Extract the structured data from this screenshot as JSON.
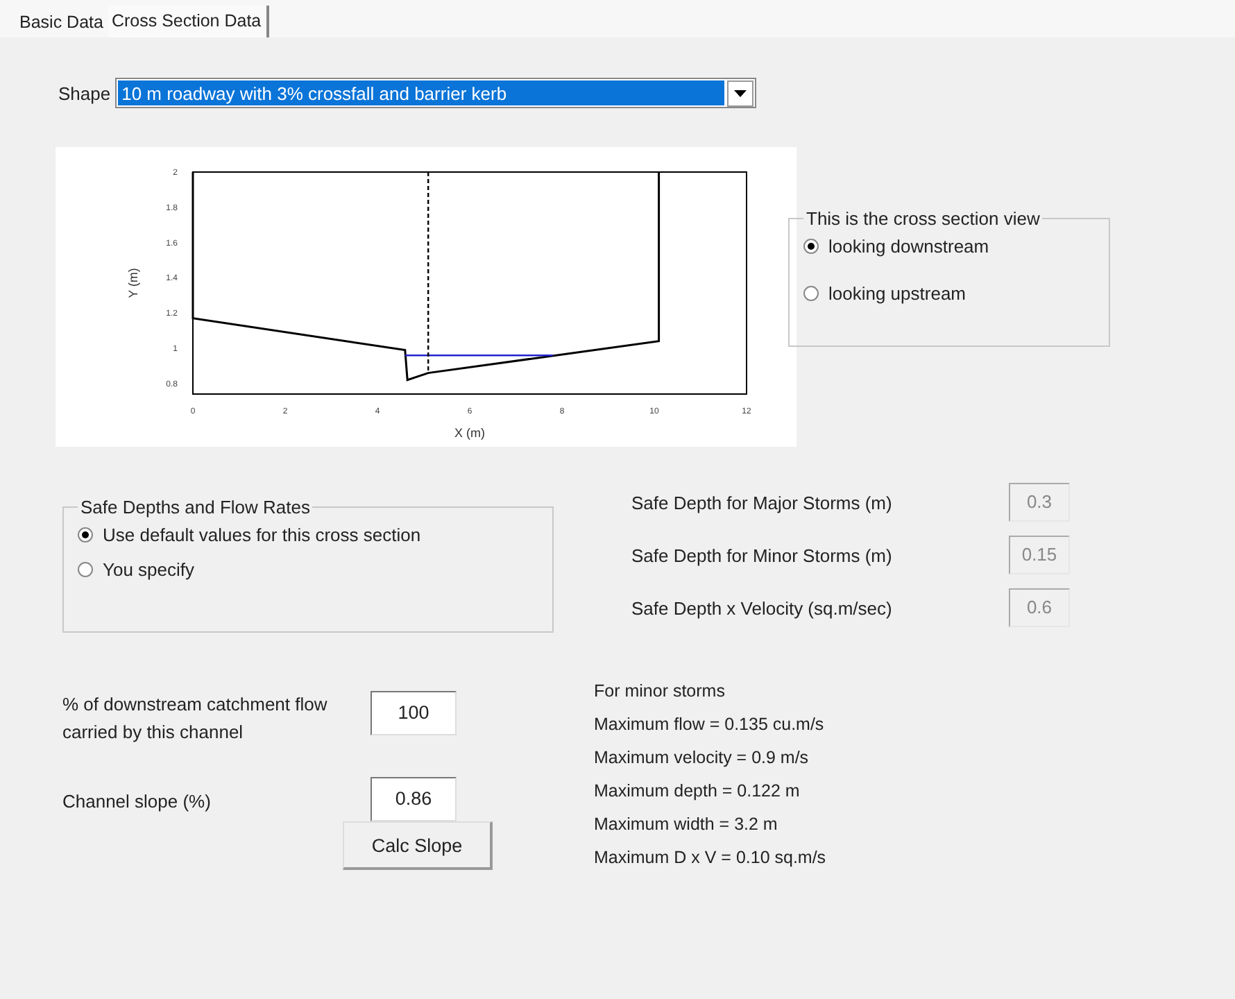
{
  "tabs": [
    {
      "label": "Basic Data",
      "selected": false
    },
    {
      "label": "Cross Section Data",
      "selected": true
    }
  ],
  "shape": {
    "label": "Shape",
    "value": "10 m roadway with 3% crossfall and barrier kerb"
  },
  "cross_section_chart": {
    "chart_data": {
      "type": "line",
      "xlabel": "X (m)",
      "ylabel": "Y (m)",
      "xlim": [
        0,
        12
      ],
      "ylim": [
        0.74,
        2
      ],
      "xticks": [
        0,
        2,
        4,
        6,
        8,
        10,
        12
      ],
      "yticks": [
        {
          "value": 0.8,
          "label": "0.8"
        },
        {
          "value": 1,
          "label": "1"
        },
        {
          "value": 1.2,
          "label": "1.2"
        },
        {
          "value": 1.4,
          "label": "1.4"
        },
        {
          "value": 1.6,
          "label": "1.6"
        },
        {
          "value": 1.8,
          "label": "1.8"
        },
        {
          "value": 2,
          "label": "2"
        }
      ],
      "series": [
        {
          "color": "#000000",
          "line_style": "solid",
          "x": [
            0,
            0,
            4.6,
            4.65,
            5.1,
            10.1,
            10.1
          ],
          "values": [
            2,
            1.17,
            0.99,
            0.82,
            0.86,
            1.04,
            2
          ]
        },
        {
          "color": "#2222cc",
          "line_style": "solid",
          "x": [
            4.6,
            7.8
          ],
          "values": [
            0.96,
            0.96
          ]
        },
        {
          "color": "#000000",
          "line_style": "dashed",
          "x": [
            5.1,
            5.1
          ],
          "values": [
            2,
            0.86
          ]
        }
      ]
    }
  },
  "view_group": {
    "title": "This is the cross section view",
    "options": [
      {
        "label": "looking downstream",
        "selected": true
      },
      {
        "label": "looking upstream",
        "selected": false
      }
    ]
  },
  "safe_group": {
    "title": "Safe Depths and Flow Rates",
    "options": [
      {
        "label": "Use default values for this cross section",
        "selected": true
      },
      {
        "label": "You specify",
        "selected": false
      }
    ]
  },
  "safe_fields": [
    {
      "label": "Safe Depth for Major Storms (m)",
      "value": "0.3",
      "disabled": true
    },
    {
      "label": "Safe Depth for Minor Storms (m)",
      "value": "0.15",
      "disabled": true
    },
    {
      "label": "Safe Depth x Velocity (sq.m/sec)",
      "value": "0.6",
      "disabled": true
    }
  ],
  "flow_share": {
    "label": "% of downstream catchment flow carried by this channel",
    "value": "100"
  },
  "channel_slope": {
    "label": "Channel slope (%)",
    "value": "0.86"
  },
  "calc_button": "Calc Slope",
  "results": {
    "title": "For minor storms",
    "lines": [
      "Maximum flow = 0.135 cu.m/s",
      "Maximum velocity = 0.9 m/s",
      "Maximum depth = 0.122 m",
      "Maximum width = 3.2 m",
      "Maximum D x V = 0.10 sq.m/s"
    ]
  }
}
